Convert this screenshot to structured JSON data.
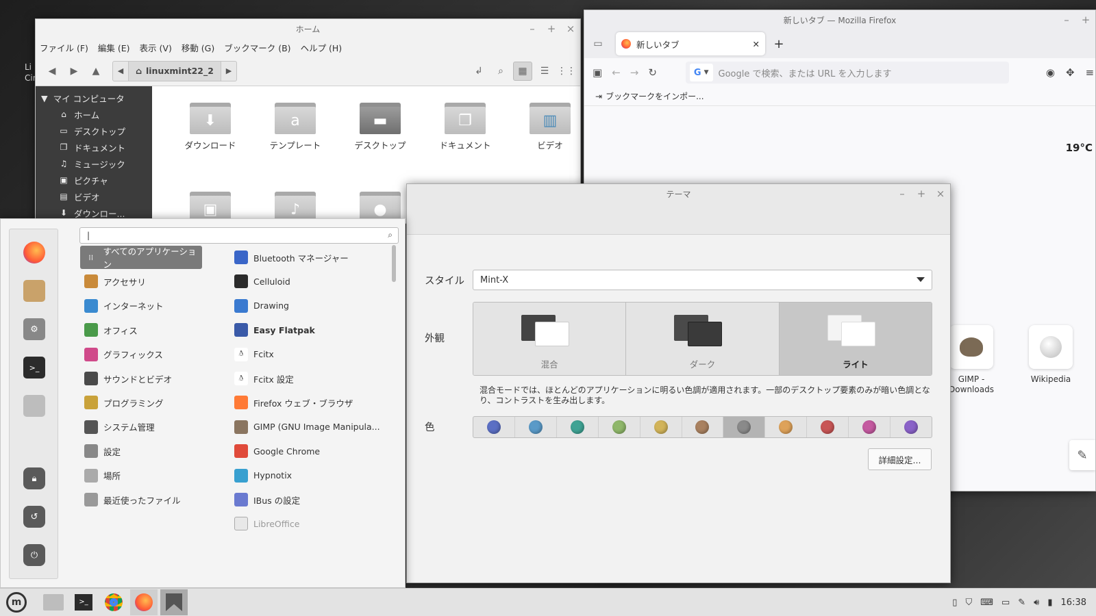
{
  "desktop": {
    "label1": "Li",
    "label2": "Cir"
  },
  "file_manager": {
    "title": "ホーム",
    "menu": [
      "ファイル (F)",
      "編集 (E)",
      "表示 (V)",
      "移動 (G)",
      "ブックマーク (B)",
      "ヘルプ (H)"
    ],
    "path": "linuxmint22_2",
    "sidebar_header": "マイ コンピュータ",
    "sidebar": [
      "ホーム",
      "デスクトップ",
      "ドキュメント",
      "ミュージック",
      "ピクチャ",
      "ビデオ",
      "ダウンロー..."
    ],
    "folders": [
      "ダウンロード",
      "テンプレート",
      "デスクトップ",
      "ドキュメント",
      "ビデオ"
    ]
  },
  "firefox": {
    "title": "新しいタブ — Mozilla Firefox",
    "tab_label": "新しいタブ",
    "url_placeholder": "Google で検索、または URL を入力します",
    "bookmark_import": "ブックマークをインポー...",
    "weather": "19°C",
    "shortcuts": [
      {
        "label": "GIMP - Downloads"
      },
      {
        "label": "Wikipedia"
      }
    ]
  },
  "theme_dialog": {
    "title": "テーマ",
    "style_label": "スタイル",
    "style_value": "Mint-X",
    "appearance_label": "外観",
    "appearance_options": [
      "混合",
      "ダーク",
      "ライト"
    ],
    "appearance_selected": "ライト",
    "description": "混合モードでは、ほとんどのアプリケーションに明るい色調が適用されます。一部のデスクトップ要素のみが暗い色調となり、コントラストを生み出します。",
    "color_label": "色",
    "colors": [
      "#5b6fc4",
      "#5a9ac8",
      "#3fa394",
      "#8fb76a",
      "#d2b45a",
      "#a98160",
      "#8a8a8a",
      "#dea25a",
      "#c85656",
      "#c45aa0",
      "#8a62c8"
    ],
    "color_selected_index": 6,
    "advanced_button": "詳細設定..."
  },
  "start_menu": {
    "search_value": "|",
    "categories": [
      "すべてのアプリケーション",
      "アクセサリ",
      "インターネット",
      "オフィス",
      "グラフィックス",
      "サウンドとビデオ",
      "プログラミング",
      "システム管理",
      "設定",
      "場所",
      "最近使ったファイル"
    ],
    "apps": [
      "Bluetooth マネージャー",
      "Celluloid",
      "Drawing",
      "Easy Flatpak",
      "Fcitx",
      "Fcitx 設定",
      "Firefox ウェブ・ブラウザ",
      "GIMP (GNU Image Manipula...",
      "Google Chrome",
      "Hypnotix",
      "IBus の設定",
      "LibreOffice"
    ]
  },
  "panel": {
    "clock": "16:38"
  }
}
